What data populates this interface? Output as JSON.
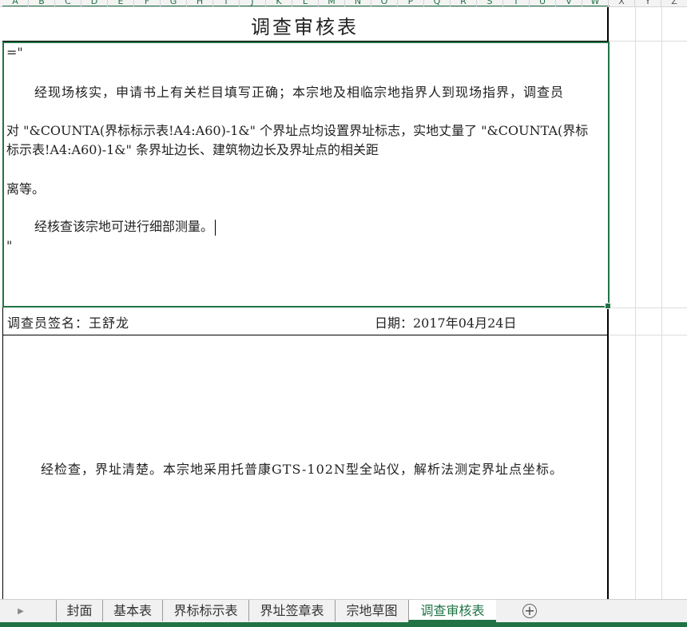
{
  "columns": [
    "A",
    "B",
    "C",
    "D",
    "E",
    "F",
    "G",
    "H",
    "I",
    "J",
    "K",
    "L",
    "M",
    "N",
    "O",
    "P",
    "Q",
    "R",
    "S",
    "T",
    "U",
    "V",
    "W",
    "X",
    "Y",
    "Z"
  ],
  "form": {
    "title": "调查审核表",
    "cell_prefix": "=\"",
    "line1": "经现场核实，申请书上有关栏目填写正确；本宗地及相临宗地指界人到现场指界，调查员",
    "line2": "对 \"&COUNTA(界标标示表!A4:A60)-1&\" 个界址点均设置界址标志，实地丈量了 \"&COUNTA(界标",
    "line3": "标示表!A4:A60)-1&\" 条界址边长、建筑物边长及界址点的相关距",
    "line4": "离等。",
    "line5": "经核查该宗地可进行细部测量。",
    "cell_suffix": "\"",
    "surveyor_label": "调查员签名：王舒龙",
    "date_label": "日期：2017年04月24日",
    "review_text": "经检查，界址清楚。本宗地采用托普康GTS-102N型全站仪，解析法测定界址点坐标。"
  },
  "sheet_tabs": [
    {
      "label": "封面",
      "active": false
    },
    {
      "label": "基本表",
      "active": false
    },
    {
      "label": "界标标示表",
      "active": false
    },
    {
      "label": "界址签章表",
      "active": false
    },
    {
      "label": "宗地草图",
      "active": false
    },
    {
      "label": "调查审核表",
      "active": true
    }
  ],
  "add_sheet_symbol": "+",
  "colors": {
    "accent": "#217346"
  }
}
